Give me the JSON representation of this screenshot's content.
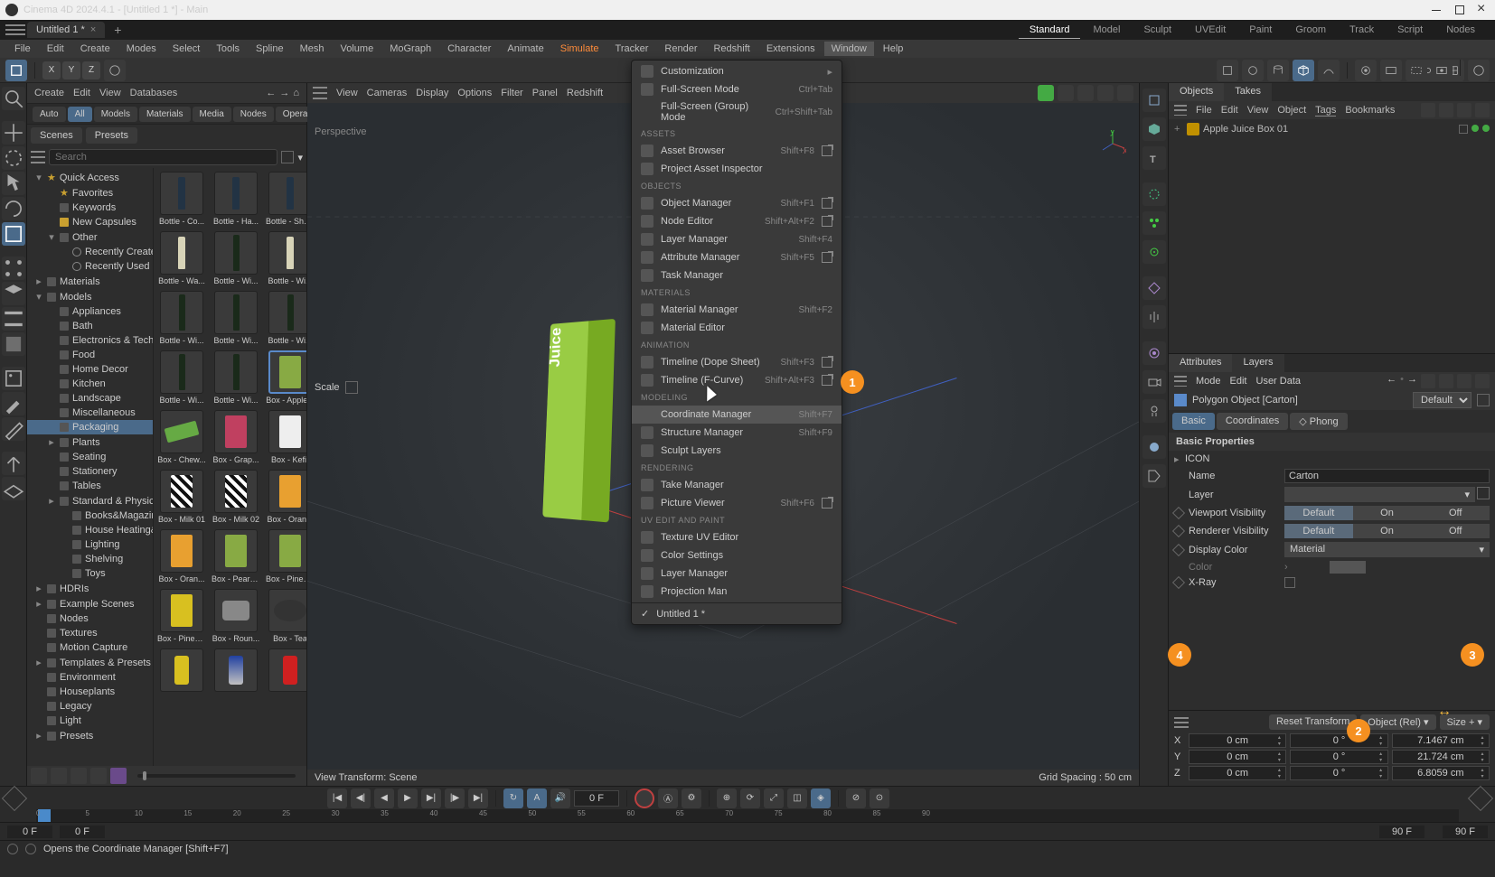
{
  "app": {
    "title": "Cinema 4D 2024.4.1 - [Untitled 1 *] - Main",
    "tab": "Untitled 1 *"
  },
  "menubar": [
    "File",
    "Edit",
    "Create",
    "Modes",
    "Select",
    "Tools",
    "Spline",
    "Mesh",
    "Volume",
    "MoGraph",
    "Character",
    "Animate",
    "Simulate",
    "Tracker",
    "Render",
    "Redshift",
    "Extensions",
    "Window",
    "Help"
  ],
  "layouttabs": [
    "Standard",
    "Model",
    "Sculpt",
    "UVEdit",
    "Paint",
    "Groom",
    "Track",
    "Script",
    "Nodes"
  ],
  "layouttab_active": "Standard",
  "axes": [
    "X",
    "Y",
    "Z"
  ],
  "asset": {
    "topmenu": [
      "Create",
      "Edit",
      "View",
      "Databases"
    ],
    "filters": [
      "Auto",
      "All",
      "Models",
      "Materials",
      "Media",
      "Nodes",
      "Operators"
    ],
    "filter_active": "All",
    "tabs": [
      "Scenes",
      "Presets"
    ],
    "search_placeholder": "Search",
    "tree": [
      {
        "l": 1,
        "label": "Quick Access",
        "exp": "–",
        "icon": "star"
      },
      {
        "l": 2,
        "label": "Favorites",
        "icon": "star"
      },
      {
        "l": 2,
        "label": "Keywords",
        "icon": "folder"
      },
      {
        "l": 2,
        "label": "New Capsules",
        "icon": "yfolder"
      },
      {
        "l": 2,
        "label": "Other",
        "exp": "–",
        "icon": "folder"
      },
      {
        "l": 3,
        "label": "Recently Created",
        "icon": "clock"
      },
      {
        "l": 3,
        "label": "Recently Used",
        "icon": "clock"
      },
      {
        "l": 1,
        "label": "Materials",
        "exp": "+",
        "icon": "folder"
      },
      {
        "l": 1,
        "label": "Models",
        "exp": "–",
        "icon": "folder"
      },
      {
        "l": 2,
        "label": "Appliances",
        "icon": "folder"
      },
      {
        "l": 2,
        "label": "Bath",
        "icon": "folder"
      },
      {
        "l": 2,
        "label": "Electronics & Techn",
        "icon": "folder"
      },
      {
        "l": 2,
        "label": "Food",
        "icon": "folder"
      },
      {
        "l": 2,
        "label": "Home Decor",
        "icon": "folder"
      },
      {
        "l": 2,
        "label": "Kitchen",
        "icon": "folder"
      },
      {
        "l": 2,
        "label": "Landscape",
        "icon": "folder"
      },
      {
        "l": 2,
        "label": "Miscellaneous",
        "icon": "folder"
      },
      {
        "l": 2,
        "label": "Packaging",
        "icon": "folder",
        "sel": true
      },
      {
        "l": 2,
        "label": "Plants",
        "exp": "+",
        "icon": "folder"
      },
      {
        "l": 2,
        "label": "Seating",
        "icon": "folder"
      },
      {
        "l": 2,
        "label": "Stationery",
        "icon": "folder"
      },
      {
        "l": 2,
        "label": "Tables",
        "icon": "folder"
      },
      {
        "l": 2,
        "label": "Standard & Physica",
        "exp": "+",
        "icon": "folder"
      },
      {
        "l": 3,
        "label": "Books&Magazines",
        "icon": "folder"
      },
      {
        "l": 3,
        "label": "House Heating&Fa",
        "icon": "folder"
      },
      {
        "l": 3,
        "label": "Lighting",
        "icon": "folder"
      },
      {
        "l": 3,
        "label": "Shelving",
        "icon": "folder"
      },
      {
        "l": 3,
        "label": "Toys",
        "icon": "folder"
      },
      {
        "l": 1,
        "label": "HDRIs",
        "exp": "+",
        "icon": "folder"
      },
      {
        "l": 1,
        "label": "Example Scenes",
        "exp": "+",
        "icon": "folder"
      },
      {
        "l": 1,
        "label": "Nodes",
        "icon": "folder"
      },
      {
        "l": 1,
        "label": "Textures",
        "icon": "folder"
      },
      {
        "l": 1,
        "label": "Motion Capture",
        "icon": "folder"
      },
      {
        "l": 1,
        "label": "Templates & Presets",
        "exp": "+",
        "icon": "folder"
      },
      {
        "l": 1,
        "label": "Environment",
        "icon": "folder"
      },
      {
        "l": 1,
        "label": "Houseplants",
        "icon": "folder"
      },
      {
        "l": 1,
        "label": "Legacy",
        "icon": "folder"
      },
      {
        "l": 1,
        "label": "Light",
        "icon": "folder"
      },
      {
        "l": 1,
        "label": "Presets",
        "exp": "+",
        "icon": "folder"
      }
    ],
    "items": [
      {
        "label": "Bottle - Co...",
        "kind": "bottle",
        "cls": ""
      },
      {
        "label": "Bottle - Ha...",
        "kind": "bottle",
        "cls": ""
      },
      {
        "label": "Bottle - Sha...",
        "kind": "bottle",
        "cls": ""
      },
      {
        "label": "Bottle - Wa...",
        "kind": "bottle",
        "cls": "white"
      },
      {
        "label": "Bottle - Wi...",
        "kind": "bottle",
        "cls": "wine"
      },
      {
        "label": "Bottle - Wi...",
        "kind": "bottle",
        "cls": "white"
      },
      {
        "label": "Bottle - Wi...",
        "kind": "bottle",
        "cls": "wine"
      },
      {
        "label": "Bottle - Wi...",
        "kind": "bottle",
        "cls": "wine"
      },
      {
        "label": "Bottle - Wi...",
        "kind": "bottle",
        "cls": "wine"
      },
      {
        "label": "Bottle - Wi...",
        "kind": "bottle",
        "cls": "wine"
      },
      {
        "label": "Bottle - Wi...",
        "kind": "bottle",
        "cls": "wine"
      },
      {
        "label": "Box - Apple...",
        "kind": "box",
        "cls": "",
        "sel": true
      },
      {
        "label": "Box - Chew...",
        "kind": "box",
        "cls": "chew"
      },
      {
        "label": "Box - Grap...",
        "kind": "box",
        "cls": "grape"
      },
      {
        "label": "Box - Kefir",
        "kind": "box",
        "cls": "kefir"
      },
      {
        "label": "Box - Milk 01",
        "kind": "box",
        "cls": "cow"
      },
      {
        "label": "Box - Milk 02",
        "kind": "box",
        "cls": "cow"
      },
      {
        "label": "Box - Oran...",
        "kind": "box",
        "cls": "orange"
      },
      {
        "label": "Box - Oran...",
        "kind": "box",
        "cls": "orange"
      },
      {
        "label": "Box - Pear J...",
        "kind": "box",
        "cls": ""
      },
      {
        "label": "Box - Pinea...",
        "kind": "box",
        "cls": ""
      },
      {
        "label": "Box - Pinea...",
        "kind": "box",
        "cls": "pine"
      },
      {
        "label": "Box - Roun...",
        "kind": "box",
        "cls": "round"
      },
      {
        "label": "Box - Tea",
        "kind": "box",
        "cls": "tea"
      },
      {
        "label": "",
        "kind": "can",
        "cls": "y"
      },
      {
        "label": "",
        "kind": "can",
        "cls": "blue"
      },
      {
        "label": "",
        "kind": "can",
        "cls": ""
      }
    ]
  },
  "viewport": {
    "menu": [
      "View",
      "Cameras",
      "Display",
      "Options",
      "Filter",
      "Panel",
      "Redshift"
    ],
    "label": "Perspective",
    "scale": "Scale",
    "footer_left": "View Transform: Scene",
    "footer_right": "Grid Spacing : 50 cm"
  },
  "winmenu": {
    "customization": "Customization",
    "fullscreen": "Full-Screen Mode",
    "fullscreen_sc": "Ctrl+Tab",
    "fullscreen_group": "Full-Screen (Group) Mode",
    "fullscreen_group_sc": "Ctrl+Shift+Tab",
    "h_assets": "ASSETS",
    "asset_browser": "Asset Browser",
    "asset_browser_sc": "Shift+F8",
    "project_asset": "Project Asset Inspector",
    "h_objects": "OBJECTS",
    "object_manager": "Object Manager",
    "object_manager_sc": "Shift+F1",
    "node_editor": "Node Editor",
    "node_editor_sc": "Shift+Alt+F2",
    "layer_manager": "Layer Manager",
    "layer_manager_sc": "Shift+F4",
    "attribute_manager": "Attribute Manager",
    "attribute_manager_sc": "Shift+F5",
    "task_manager": "Task Manager",
    "h_materials": "MATERIALS",
    "material_manager": "Material Manager",
    "material_manager_sc": "Shift+F2",
    "material_editor": "Material Editor",
    "h_animation": "ANIMATION",
    "timeline_dope": "Timeline (Dope Sheet)",
    "timeline_dope_sc": "Shift+F3",
    "timeline_fcurve": "Timeline (F-Curve)",
    "timeline_fcurve_sc": "Shift+Alt+F3",
    "h_modeling": "MODELING",
    "coord_manager": "Coordinate Manager",
    "coord_manager_sc": "Shift+F7",
    "structure_manager": "Structure Manager",
    "structure_manager_sc": "Shift+F9",
    "sculpt_layers": "Sculpt Layers",
    "h_rendering": "RENDERING",
    "take_manager": "Take Manager",
    "picture_viewer": "Picture Viewer",
    "picture_viewer_sc": "Shift+F6",
    "h_uv": "UV EDIT AND PAINT",
    "texture_uv": "Texture UV Editor",
    "color_settings": "Color Settings",
    "layer_manager2": "Layer Manager",
    "projection_man": "Projection Man",
    "untitled": "Untitled 1 *"
  },
  "objects": {
    "tabs": [
      "Objects",
      "Takes"
    ],
    "menu": [
      "File",
      "Edit",
      "View",
      "Object",
      "Tags",
      "Bookmarks"
    ],
    "item": "Apple Juice Box 01"
  },
  "attributes": {
    "tabs": [
      "Attributes",
      "Layers"
    ],
    "menu": [
      "Mode",
      "Edit",
      "User Data"
    ],
    "objtype": "Polygon Object [Carton]",
    "default": "Default",
    "chips": [
      "Basic",
      "Coordinates",
      "Phong"
    ],
    "chip_active": "Basic",
    "section": "Basic Properties",
    "icon_section": "ICON",
    "name_lbl": "Name",
    "name_val": "Carton",
    "layer_lbl": "Layer",
    "vp_vis_lbl": "Viewport Visibility",
    "ren_vis_lbl": "Renderer Visibility",
    "seg_default": "Default",
    "seg_on": "On",
    "seg_off": "Off",
    "display_color_lbl": "Display Color",
    "display_color_val": "Material",
    "color_lbl": "Color",
    "xray_lbl": "X-Ray"
  },
  "coords": {
    "reset": "Reset Transform",
    "mode": "Object (Rel)",
    "size": "Size +",
    "rows": [
      {
        "ax": "X",
        "pos": "0 cm",
        "rot": "0 °",
        "size": "7.1467 cm"
      },
      {
        "ax": "Y",
        "pos": "0 cm",
        "rot": "0 °",
        "size": "21.724 cm"
      },
      {
        "ax": "Z",
        "pos": "0 cm",
        "rot": "0 °",
        "size": "6.8059 cm"
      }
    ]
  },
  "timeline": {
    "frame": "0 F",
    "ticks": [
      "0",
      "5",
      "10",
      "15",
      "20",
      "25",
      "30",
      "35",
      "40",
      "45",
      "50",
      "55",
      "60",
      "65",
      "70",
      "75",
      "80",
      "85",
      "90"
    ],
    "end1": "90 F",
    "end2": "90 F",
    "start1": "0 F",
    "start2": "0 F"
  },
  "status": "Opens the Coordinate Manager [Shift+F7]",
  "badges": [
    "1",
    "2",
    "3",
    "4"
  ]
}
